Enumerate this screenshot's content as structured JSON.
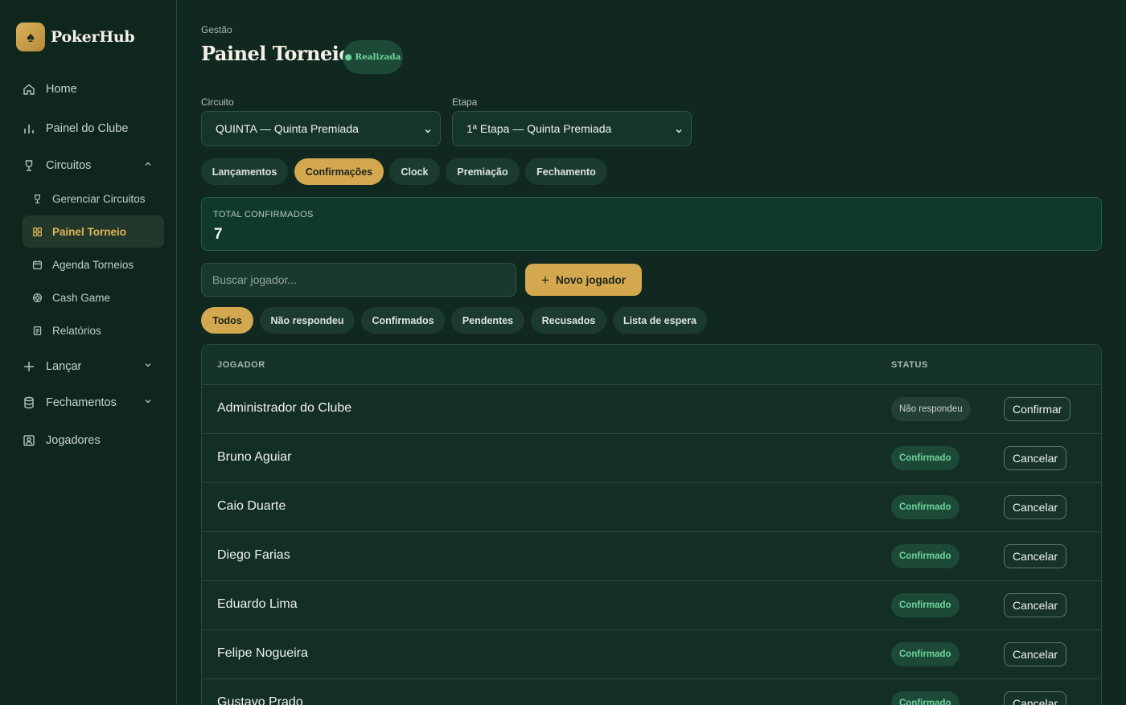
{
  "brand": {
    "name": "PokerHub",
    "logo_icon": "spade-icon",
    "logo_glyph": "♠"
  },
  "sidebar": {
    "items": [
      {
        "label": "Home",
        "icon": "home-icon"
      },
      {
        "label": "Painel do Clube",
        "icon": "bar-chart-icon"
      },
      {
        "label": "Circuitos",
        "icon": "trophy-icon",
        "expanded": true
      },
      {
        "label": "Lançar",
        "icon": "plus-icon",
        "expanded": false
      },
      {
        "label": "Fechamentos",
        "icon": "database-icon",
        "expanded": false
      },
      {
        "label": "Jogadores",
        "icon": "contact-icon"
      }
    ],
    "sub_items": [
      {
        "label": "Gerenciar Circuitos",
        "icon": "trophy-icon"
      },
      {
        "label": "Painel Torneio",
        "icon": "grid-icon",
        "active": true
      },
      {
        "label": "Agenda Torneios",
        "icon": "calendar-icon"
      },
      {
        "label": "Cash Game",
        "icon": "chip-icon"
      },
      {
        "label": "Relatórios",
        "icon": "report-icon"
      }
    ]
  },
  "header": {
    "breadcrumb": "Gestão",
    "title": "Painel Torneio",
    "status": "● Realizada"
  },
  "filters_top": {
    "circuit_label": "Circuito",
    "circuit_value": "QUINTA — Quinta Premiada",
    "stage_label": "Etapa",
    "stage_value": "1ª Etapa — Quinta Premiada"
  },
  "tabs": [
    "Lançamentos",
    "Confirmações",
    "Clock",
    "Premiação",
    "Fechamento"
  ],
  "active_tab": "Confirmações",
  "summary": {
    "label": "TOTAL CONFIRMADOS",
    "value": "7"
  },
  "search": {
    "placeholder": "Buscar jogador...",
    "value": ""
  },
  "new_player_button": {
    "label": "Novo jogador",
    "glyph": "+"
  },
  "status_filters": [
    "Todos",
    "Não respondeu",
    "Confirmados",
    "Pendentes",
    "Recusados",
    "Lista de espera"
  ],
  "active_status_filter": "Todos",
  "table": {
    "columns": [
      "JOGADOR",
      "STATUS"
    ],
    "rows": [
      {
        "player": "Administrador do Clube",
        "status": "Não respondeu",
        "action": "Confirmar"
      },
      {
        "player": "Bruno Aguiar",
        "status": "Confirmado",
        "action": "Cancelar"
      },
      {
        "player": "Caio Duarte",
        "status": "Confirmado",
        "action": "Cancelar"
      },
      {
        "player": "Diego Farias",
        "status": "Confirmado",
        "action": "Cancelar"
      },
      {
        "player": "Eduardo Lima",
        "status": "Confirmado",
        "action": "Cancelar"
      },
      {
        "player": "Felipe Nogueira",
        "status": "Confirmado",
        "action": "Cancelar"
      },
      {
        "player": "Gustavo Prado",
        "status": "Confirmado",
        "action": "Cancelar"
      }
    ]
  },
  "colors": {
    "accent": "#d4a84f",
    "background": "#10281f",
    "success": "#6fd4a0"
  }
}
